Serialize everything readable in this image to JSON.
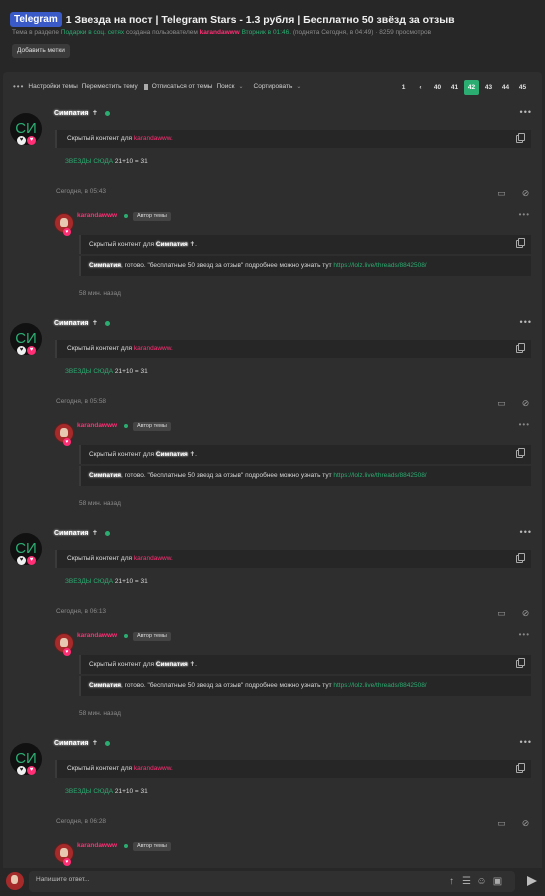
{
  "header": {
    "tag": "Telegram",
    "title": "1 Звезда на пост | Telegram Stars - 1.3 рубля | Бесплатно 50 звёзд за отзыв",
    "meta_prefix": "Тема в разделе",
    "meta_section": "Подарки в соц. сетях",
    "meta_created": "создана пользователем",
    "meta_author": "karandawww",
    "meta_date": "Вторник в 01:46.",
    "meta_bumped": "(поднята Сегодня, в 04:49)",
    "meta_views": "· 8259 просмотров",
    "add_labels": "Добавить метки"
  },
  "toolbar": {
    "settings": "Настройки темы",
    "move": "Переместить тему",
    "unsubscribe": "Отписаться от темы",
    "search": "Поиск",
    "sort": "Сортировать"
  },
  "pager": [
    "1",
    "‹",
    "40",
    "41",
    "42",
    "43",
    "44",
    "45"
  ],
  "avatar_initials": "СИ",
  "posts": [
    {
      "username": "Симпатия",
      "hidden_prefix": "Скрытый контент для",
      "hidden_user": "karandawww.",
      "stars_label": "ЗВЕЗДЫ СЮДА",
      "stars_value": "21+10 = 31",
      "date": "Сегодня, в 05:43"
    },
    {
      "username": "Симпатия",
      "hidden_prefix": "Скрытый контент для",
      "hidden_user": "karandawww.",
      "stars_label": "ЗВЕЗДЫ СЮДА",
      "stars_value": "21+10 = 31",
      "date": "Сегодня, в 05:58"
    },
    {
      "username": "Симпатия",
      "hidden_prefix": "Скрытый контент для",
      "hidden_user": "karandawww.",
      "stars_label": "ЗВЕЗДЫ СЮДА",
      "stars_value": "21+10 = 31",
      "date": "Сегодня, в 06:13"
    },
    {
      "username": "Симпатия",
      "hidden_prefix": "Скрытый контент для",
      "hidden_user": "karandawww.",
      "stars_label": "ЗВЕЗДЫ СЮДА",
      "stars_value": "21+10 = 31",
      "date": "Сегодня, в 06:28"
    }
  ],
  "reply": {
    "name": "karandawww",
    "badge": "Автор темы",
    "quote_prefix": "Скрытый контент для",
    "quote_user": "Симпатия",
    "body_user": "Симпатия",
    "body_text": ", готово. \"бесплатные 50 звезд за отзыв\" подробнее можно узнать тут",
    "link": "https://lolz.live/threads/8842508/",
    "time": "58 мин. назад"
  },
  "composer": {
    "placeholder": "Напишите ответ..."
  },
  "colors": {
    "accent_green": "#2bad72",
    "accent_pink": "#ff2e75",
    "tag_blue": "#3a5bc7",
    "background": "#272727"
  },
  "icons": {
    "reply": "comment-icon",
    "hide": "eye-off-icon",
    "copy": "copy-icon",
    "send": "send-icon"
  }
}
